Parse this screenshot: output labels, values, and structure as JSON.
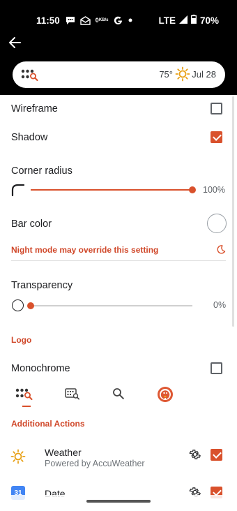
{
  "status_bar": {
    "time": "11:50",
    "speed_value": "0",
    "speed_unit": "KB/s",
    "network": "LTE",
    "battery": "70%"
  },
  "header": {
    "back_label": "Back"
  },
  "search_widget": {
    "temperature": "75°",
    "date": "Jul 28"
  },
  "settings": {
    "wireframe": {
      "label": "Wireframe",
      "checked": false
    },
    "shadow": {
      "label": "Shadow",
      "checked": true
    },
    "corner_radius": {
      "label": "Corner radius",
      "value": "100%",
      "level": 1.0
    },
    "bar_color": {
      "label": "Bar color"
    },
    "night_mode_note": "Night mode may override this setting",
    "transparency": {
      "label": "Transparency",
      "value": "0%",
      "level": 0.0
    },
    "logo_section": "Logo",
    "monochrome": {
      "label": "Monochrome",
      "checked": false
    },
    "additional_actions_section": "Additional Actions",
    "weather": {
      "title": "Weather",
      "subtitle": "Powered by AccuWeather",
      "checked": true
    },
    "date": {
      "title": "Date",
      "icon_number": "31",
      "checked": true
    }
  },
  "colors": {
    "accent": "#d9512c",
    "header_bg": "#000000"
  },
  "icons": [
    "back-arrow-icon",
    "sun-icon",
    "gear-icon",
    "moon-icon",
    "search-icon",
    "duckduckgo-icon",
    "calendar-icon"
  ]
}
